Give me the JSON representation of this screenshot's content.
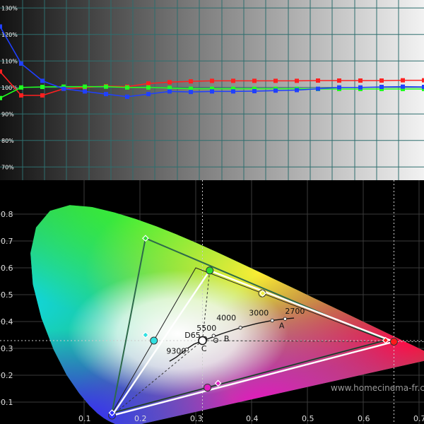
{
  "chart_data": [
    {
      "type": "line",
      "y_tick_labels": [
        "70%",
        "80%",
        "90%",
        "100%",
        "110%",
        "120%",
        "130%"
      ],
      "ylim": [
        65,
        133
      ],
      "xlim": [
        0,
        100
      ],
      "grid": true,
      "x": [
        0,
        5,
        10,
        15,
        20,
        25,
        30,
        35,
        40,
        45,
        50,
        55,
        60,
        65,
        70,
        75,
        80,
        85,
        90,
        95,
        100
      ],
      "series": [
        {
          "color": "#ff2020",
          "values": [
            106,
            97,
            97,
            99.5,
            100,
            100.5,
            100.3,
            101.5,
            102,
            102.3,
            102.5,
            102.5,
            102.5,
            102.5,
            102.5,
            102.6,
            102.6,
            102.6,
            102.6,
            102.7,
            102.7
          ]
        },
        {
          "color": "#20ff20",
          "values": [
            96,
            100,
            100.2,
            100.3,
            100.3,
            100.3,
            100,
            100,
            99.8,
            99.5,
            99.5,
            99.5,
            99.5,
            99.5,
            99.5,
            99.4,
            99.4,
            99.4,
            99.4,
            99.4,
            99.4
          ]
        },
        {
          "color": "#2040ff",
          "values": [
            123,
            109,
            102.5,
            99.5,
            98.5,
            97.5,
            96.5,
            97.5,
            98.5,
            98.3,
            98.5,
            98.5,
            98.6,
            98.8,
            99,
            99.5,
            100,
            100,
            100.2,
            100.3,
            100.2
          ]
        }
      ]
    },
    {
      "type": "scatter",
      "x_tick_labels": [
        "0.1",
        "0.2",
        "0.3",
        "0.4",
        "0.5",
        "0.6",
        "0.7"
      ],
      "y_tick_labels": [
        "0.1",
        "0.2",
        "0.3",
        "0.4",
        "0.5",
        "0.6",
        "0.7",
        "0.8"
      ],
      "xlim": [
        0.0,
        0.74
      ],
      "ylim": [
        0.0,
        0.85
      ],
      "grid": true,
      "reference_gamut": [
        [
          0.64,
          0.33
        ],
        [
          0.3,
          0.6
        ],
        [
          0.15,
          0.06
        ]
      ],
      "measured_gamut": [
        [
          0.655,
          0.325
        ],
        [
          0.325,
          0.59
        ],
        [
          0.15,
          0.05
        ]
      ],
      "wide_gamut": [
        [
          0.64,
          0.33
        ],
        [
          0.21,
          0.71
        ],
        [
          0.15,
          0.06
        ]
      ],
      "red_points": [
        [
          0.655,
          0.325
        ],
        [
          0.64,
          0.33
        ]
      ],
      "green_points": [
        [
          0.325,
          0.59
        ],
        [
          0.21,
          0.71
        ]
      ],
      "blue_points": [
        [
          0.15,
          0.05
        ],
        [
          0.15,
          0.06
        ]
      ],
      "cyan_points": [
        [
          0.225,
          0.329
        ],
        [
          0.21,
          0.35
        ]
      ],
      "magenta_points": [
        [
          0.321,
          0.154
        ],
        [
          0.34,
          0.17
        ]
      ],
      "yellow_points": [
        [
          0.419,
          0.505
        ],
        [
          0.42,
          0.505
        ]
      ],
      "white_point": [
        0.312,
        0.329
      ],
      "planckian_locus": [
        [
          0.253,
          0.252
        ],
        [
          0.265,
          0.267
        ],
        [
          0.283,
          0.297
        ],
        [
          0.297,
          0.316
        ],
        [
          0.313,
          0.329
        ],
        [
          0.33,
          0.342
        ],
        [
          0.347,
          0.355
        ],
        [
          0.38,
          0.377
        ],
        [
          0.41,
          0.393
        ],
        [
          0.437,
          0.404
        ],
        [
          0.46,
          0.41
        ],
        [
          0.476,
          0.413
        ]
      ],
      "cct_labels": [
        {
          "text": "9300",
          "x": 0.284,
          "y": 0.296
        },
        {
          "text": "D65",
          "x": 0.313,
          "y": 0.329
        },
        {
          "text": "5500",
          "x": 0.332,
          "y": 0.347
        },
        {
          "text": "4000",
          "x": 0.38,
          "y": 0.377
        },
        {
          "text": "3000",
          "x": 0.437,
          "y": 0.404
        },
        {
          "text": "2700",
          "x": 0.46,
          "y": 0.41
        },
        {
          "text": "A",
          "x": 0.448,
          "y": 0.407
        },
        {
          "text": "B",
          "x": 0.348,
          "y": 0.352
        },
        {
          "text": "C",
          "x": 0.31,
          "y": 0.316
        }
      ],
      "grayscale_points": [
        [
          0.316,
          0.336
        ],
        [
          0.31,
          0.335
        ],
        [
          0.312,
          0.332
        ],
        [
          0.314,
          0.326
        ],
        [
          0.315,
          0.328
        ],
        [
          0.336,
          0.33
        ]
      ]
    }
  ],
  "watermark": "www.homecinema-fr.com"
}
